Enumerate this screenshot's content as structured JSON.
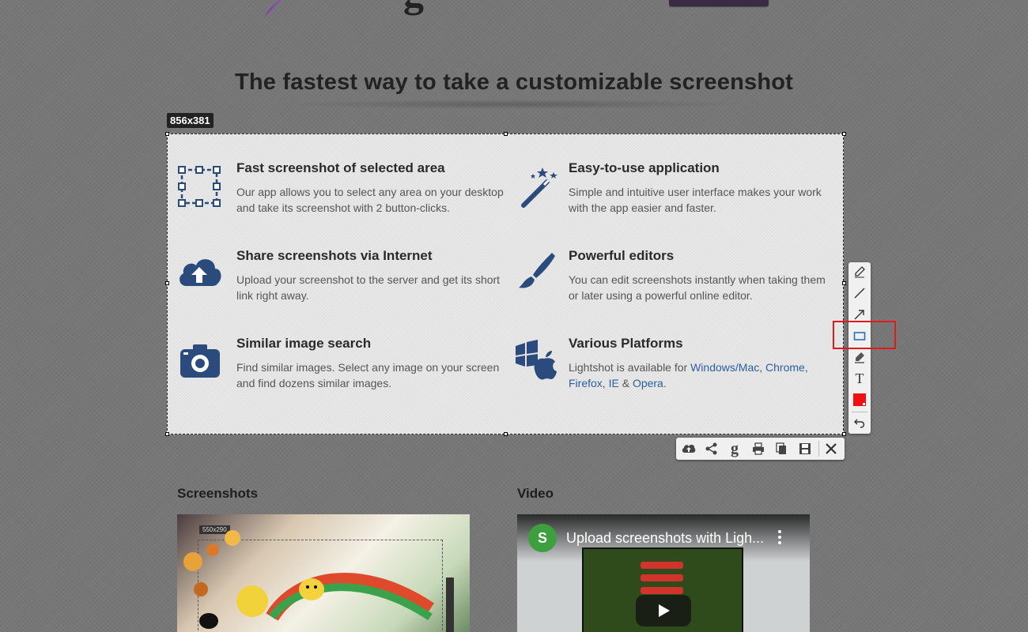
{
  "header": {
    "headline": "The fastest way to take a customizable screenshot"
  },
  "selection": {
    "size_label": "856x381"
  },
  "features": [
    {
      "title": "Fast screenshot of selected area",
      "desc": "Our app allows you to select any area on your desktop and take its screenshot with 2 button-clicks.",
      "icon": "selection-area-icon"
    },
    {
      "title": "Easy-to-use application",
      "desc": "Simple and intuitive user interface makes your work with the app easier and faster.",
      "icon": "magic-wand-icon"
    },
    {
      "title": "Share screenshots via Internet",
      "desc": "Upload your screenshot to the server and get its short link right away.",
      "icon": "cloud-upload-icon"
    },
    {
      "title": "Powerful editors",
      "desc": "You can edit screenshots instantly when taking them or later using a powerful online editor.",
      "icon": "paint-brush-icon"
    },
    {
      "title": "Similar image search",
      "desc": "Find similar images. Select any image on your screen and find dozens similar images.",
      "icon": "camera-icon"
    },
    {
      "title": "Various Platforms",
      "desc_prefix": "Lightshot is available for ",
      "links": {
        "windows_mac": "Windows/Mac",
        "chrome": "Chrome",
        "firefox": "Firefox",
        "ie": "IE",
        "opera": "Opera"
      },
      "icon": "platforms-icon"
    }
  ],
  "side_toolbar": {
    "tools": [
      "pen-icon",
      "line-icon",
      "arrow-icon",
      "rectangle-icon",
      "marker-icon",
      "text-icon",
      "color-icon",
      "undo-icon"
    ],
    "text_tool_glyph": "T",
    "color": "#ee1111"
  },
  "bottom_toolbar": {
    "tools": [
      "upload-icon",
      "share-icon",
      "google-search-icon",
      "print-icon",
      "copy-icon",
      "save-icon",
      "close-icon"
    ],
    "google_glyph": "g"
  },
  "sections": {
    "screenshots_title": "Screenshots",
    "video_title": "Video",
    "thumb_size_label": "550x290",
    "video_channel_initial": "S",
    "video_title_text": "Upload screenshots with Ligh..."
  },
  "colors": {
    "accent": "#2b5f9e",
    "highlight": "#e01b1b",
    "icon_blue": "#2a4b7c"
  }
}
